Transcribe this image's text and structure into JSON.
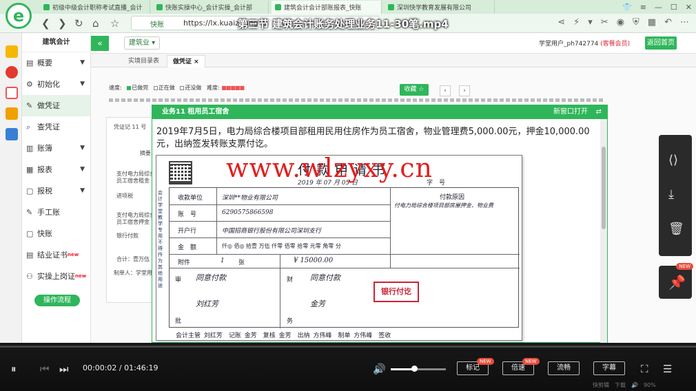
{
  "browser": {
    "tabs": [
      "初级中级会计职称考试直播_会计",
      "快账实操中心_会计实操_会计部",
      "建筑会计会计部账报表_快账",
      "深圳快学教育发展有限公司"
    ],
    "url": "https://lx.kuaizhang",
    "url_label": "快账"
  },
  "video": {
    "title": "第三节 建筑会计账务处理业务11-30笔.mp4",
    "current_time": "00:00:02",
    "total_time": "01:46:19",
    "buttons": {
      "mark": "标记",
      "speed": "倍速",
      "smooth": "流畅",
      "subtitle": "字幕"
    },
    "new_badge": "NEW",
    "volume": 0.42
  },
  "app": {
    "sidebar_title": "建筑会计",
    "sidebar_items": [
      {
        "label": "概要",
        "icon": "grid-icon",
        "chevron": true
      },
      {
        "label": "初始化",
        "icon": "gear-icon",
        "chevron": true
      },
      {
        "label": "做凭证",
        "icon": "pen-icon",
        "chevron": false,
        "active": true
      },
      {
        "label": "查凭证",
        "icon": "search-icon",
        "chevron": false
      },
      {
        "label": "账簿",
        "icon": "book-icon",
        "chevron": true
      },
      {
        "label": "报表",
        "icon": "report-icon",
        "chevron": true
      },
      {
        "label": "报税",
        "icon": "tax-icon",
        "chevron": true
      },
      {
        "label": "手工账",
        "icon": "pen-icon",
        "chevron": false
      },
      {
        "label": "快账",
        "icon": "doc-icon",
        "chevron": false
      },
      {
        "label": "结业证书",
        "icon": "cert-icon",
        "chevron": false,
        "badge": "new"
      },
      {
        "label": "实操上岗证",
        "icon": "badge-icon",
        "chevron": false,
        "badge": "new"
      }
    ],
    "flow_button": "操作流程",
    "industry": "建筑业",
    "user_text": "学堂用户_ph742774",
    "vip_text": "(客餐会员)",
    "home_button": "返回首页",
    "page_tabs": [
      "实境目录表",
      "做凭证"
    ]
  },
  "progress": {
    "speed_label": "速度:",
    "done": "已做完",
    "doing": "正在做",
    "todo": "还没做",
    "difficulty_label": "难度:",
    "favorite_button": "收藏",
    "prev": "‹",
    "next": "›"
  },
  "voucher": {
    "header": "凭证记 11 号",
    "summary_label": "摘要",
    "rows": [
      "支付电力局综合楼",
      "员工宿舍租金",
      "进项税",
      "支付电力局综合楼",
      "员工宿舍押金",
      "银行付款"
    ],
    "total": "合计：壹万伍",
    "maker": "制单人：学堂用"
  },
  "task": {
    "title": "业务11 租用员工宿舍",
    "new_window": "新窗口打开",
    "description": "2019年7月5日，电力局综合楼项目部租用民用住房作为员工宿舍，物业管理费5,000.00元，押金10,000.00元，出纳签发转账支票付讫。"
  },
  "payment_form": {
    "title": "付款申请书",
    "date": "2019 年 07 月 05 日",
    "number_label": "字　号",
    "side_text": "会计学堂教学专用 不得作为其他用途",
    "payee_label": "收款单位",
    "payee_value": "深圳**物业有限公司",
    "account_label": "账　号",
    "account_value": "6290575866598",
    "bank_label": "开户行",
    "bank_value": "中国招商银行股份有限公司深圳支行",
    "amount_label": "金　额",
    "amount_units": "仟◎ 佰◎ 拾壹 万伍 仟零 佰零 拾零 元零 角零 分",
    "attachment_label": "附件",
    "attachment_count": "1",
    "attachment_unit": "张",
    "amount_number": "¥ 15000.00",
    "reason_label": "付款原因",
    "reason_value": "付电力局综合楼项目部房屋押金、物业费",
    "approve_label": "审",
    "approve_label2": "批",
    "approve_text": "同意付款",
    "approve_sign": "刘红芳",
    "finance_label": "财",
    "finance_label2": "务",
    "finance_text": "同意付款",
    "finance_sign": "金芳",
    "stamp": "银行付讫",
    "footer": "会计主管 刘红芳　记账 金芳　复核 金芳　出纳 方伟峰　制单 方伟峰　签收"
  },
  "watermark": "www.wlzyxy.cn",
  "statusbar": "快剪辑　下载　🔊　90%"
}
